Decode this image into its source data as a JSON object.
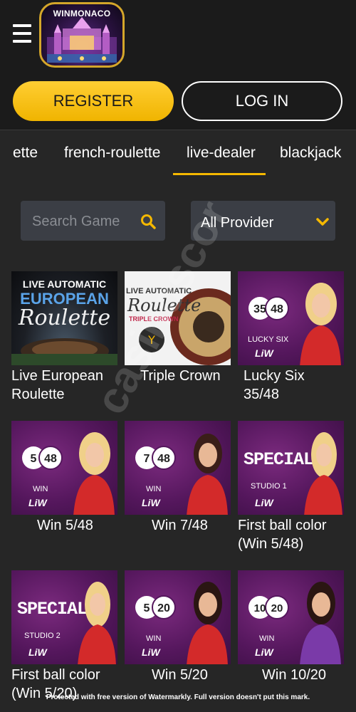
{
  "header": {
    "logo_text": "WINMONACO"
  },
  "auth": {
    "register_label": "REGISTER",
    "login_label": "LOG IN"
  },
  "tabs": [
    {
      "label": "ette"
    },
    {
      "label": "french-roulette"
    },
    {
      "label": "live-dealer",
      "active": true
    },
    {
      "label": "blackjack"
    }
  ],
  "search": {
    "placeholder": "Search Game"
  },
  "provider": {
    "selected": "All Provider"
  },
  "games": [
    {
      "title": "Live European Roulette",
      "title_lines": [
        "Live European",
        "Roulette"
      ],
      "thumb_text": [
        "LIVE AUTOMATIC",
        "EUROPEAN",
        "Roulette"
      ]
    },
    {
      "title": "Triple Crown",
      "thumb_text": [
        "LIVE AUTOMATIC",
        "Roulette",
        "TRIPLE CROWN"
      ]
    },
    {
      "title": "Lucky Six 35/48",
      "badge": [
        "35",
        "48"
      ],
      "badge_label": "LUCKY SIX",
      "brand": "LiW"
    },
    {
      "title": "Win 5/48",
      "badge": [
        "5",
        "48"
      ],
      "badge_label": "WIN",
      "brand": "LiW"
    },
    {
      "title": "Win 7/48",
      "badge": [
        "7",
        "48"
      ],
      "badge_label": "WIN",
      "brand": "LiW"
    },
    {
      "title": "First ball color (Win 5/48)",
      "title_lines": [
        "First ball color",
        "(Win 5/48)"
      ],
      "special": "SPECIAL",
      "studio": "STUDIO 1",
      "brand": "LiW"
    },
    {
      "title": "First ball color (Win 5/20)",
      "title_lines": [
        "First ball color",
        "(Win 5/20)"
      ],
      "special": "SPECIAL",
      "studio": "STUDIO 2",
      "brand": "LiW"
    },
    {
      "title": "Win 5/20",
      "badge": [
        "5",
        "20"
      ],
      "badge_label": "WIN",
      "brand": "LiW"
    },
    {
      "title": "Win 10/20",
      "badge": [
        "10",
        "20"
      ],
      "badge_label": "WIN",
      "brand": "LiW"
    }
  ],
  "watermark": "casinoscor",
  "footer_note": "Protected with free version of Watermarkly. Full version doesn't put this mark.",
  "colors": {
    "accent": "#f5b800",
    "background": "#262626",
    "header": "#1b1b1b",
    "input_bg": "#3b3e45",
    "tile_purple": "#55175d"
  }
}
